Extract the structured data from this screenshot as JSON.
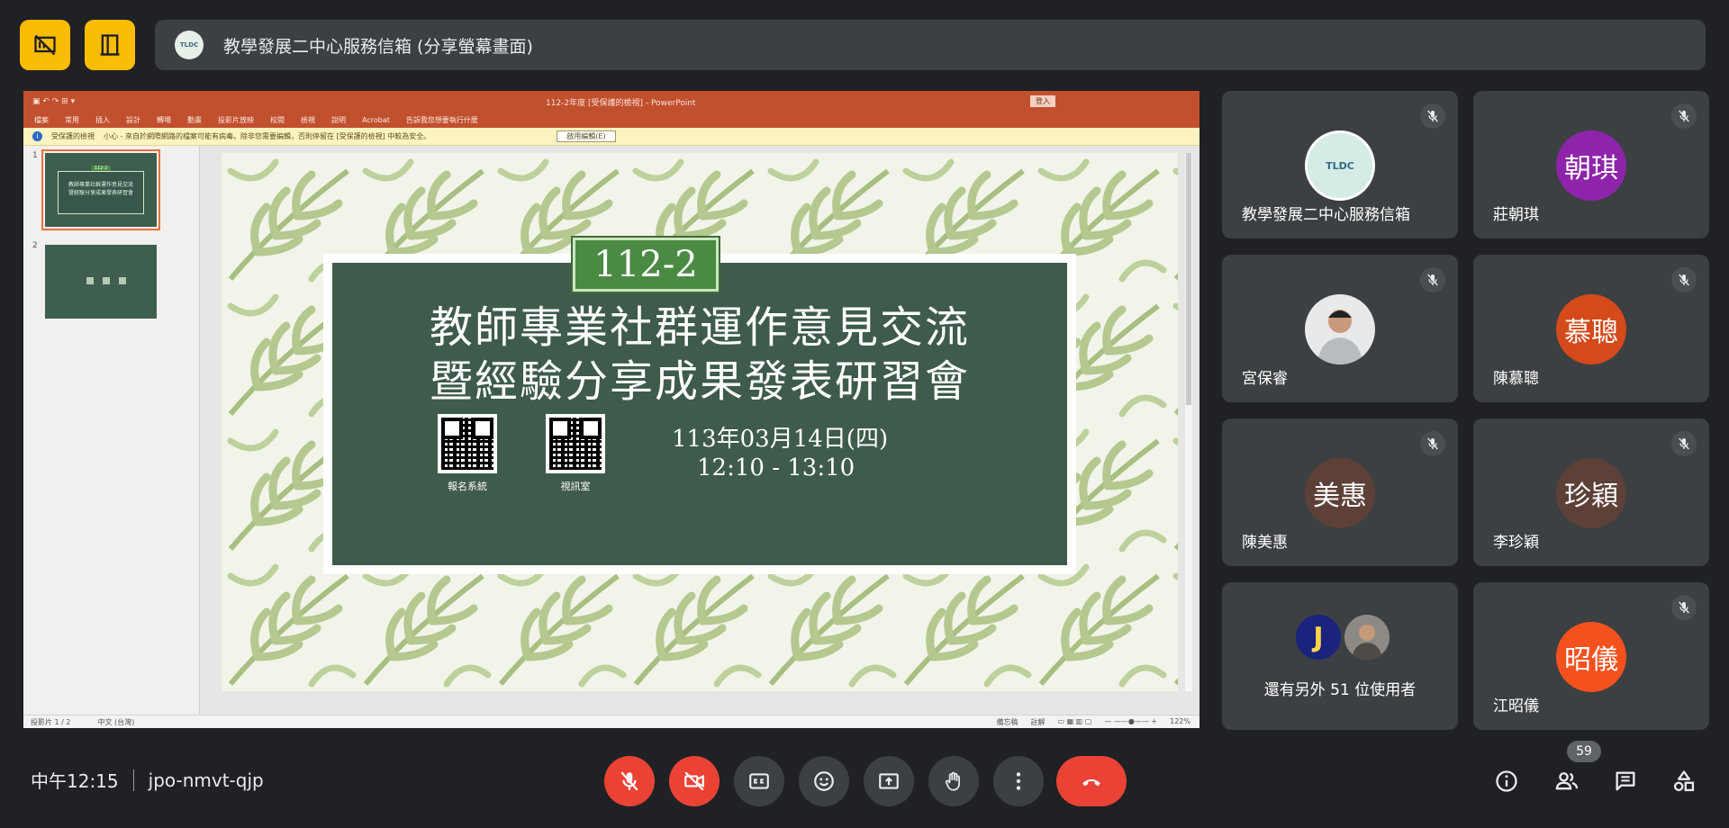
{
  "header": {
    "presenter_title": "教學發展二中心服務信箱 (分享螢幕畫面)",
    "logo_text": "TLDC"
  },
  "ppt": {
    "doc_title": "112-2年度 [受保護的檢視] - PowerPoint",
    "login_label": "登入",
    "menu": [
      "檔案",
      "常用",
      "插入",
      "設計",
      "轉場",
      "動畫",
      "投影片放映",
      "校閱",
      "檢視",
      "說明",
      "Acrobat",
      "告訴我您想要執行什麼"
    ],
    "warning_title": "受保護的檢視",
    "warning_text": "小心 - 來自於網際網路的檔案可能有病毒。除非您需要編輯，否則停留在 [受保護的檢視] 中較為安全。",
    "enable_label": "啟用編輯(E)",
    "thumb_numbers": [
      "1",
      "2"
    ],
    "status_left": "投影片 1 / 2",
    "status_lang": "中文 (台灣)",
    "status_notes": "備忘稿",
    "status_comments": "註解",
    "zoom": "122%"
  },
  "slide": {
    "tag": "112-2",
    "title_line1": "教師專業社群運作意見交流",
    "title_line2": "暨經驗分享成果發表研習會",
    "qr1_label": "報名系統",
    "qr2_label": "視訊室",
    "date_line1": "113年03月14日(四)",
    "date_line2": "12:10 - 13:10"
  },
  "participants": [
    {
      "name": "教學發展二中心服務信箱",
      "avatar": "TLDC",
      "color": "#d4ebe6"
    },
    {
      "name": "莊朝琪",
      "avatar": "朝琪",
      "color": "#8e24aa"
    },
    {
      "name": "宮保睿",
      "avatar": "",
      "color": "#e9e9e9"
    },
    {
      "name": "陳慕聰",
      "avatar": "慕聰",
      "color": "#d44a1a"
    },
    {
      "name": "陳美惠",
      "avatar": "美惠",
      "color": "#5d4037"
    },
    {
      "name": "李珍穎",
      "avatar": "珍穎",
      "color": "#5d4037"
    },
    {
      "name": "還有另外 51 位使用者",
      "avatar": "J",
      "color": "#1a237e"
    },
    {
      "name": "江昭儀",
      "avatar": "昭儀",
      "color": "#f4511e"
    }
  ],
  "bottom": {
    "time": "中午12:15",
    "meeting_code": "jpo-nmvt-qjp",
    "people_count": "59"
  },
  "icons": {
    "present": "present-icon",
    "layout": "layout-icon",
    "mic_off": "mic-off-icon",
    "cam_off": "camera-off-icon",
    "captions": "captions-icon",
    "emoji": "emoji-icon",
    "share": "present-screen-icon",
    "hand": "raise-hand-icon",
    "more": "more-vert-icon",
    "end": "end-call-icon",
    "info": "info-icon",
    "people": "people-icon",
    "chat": "chat-icon",
    "activities": "activities-icon"
  }
}
